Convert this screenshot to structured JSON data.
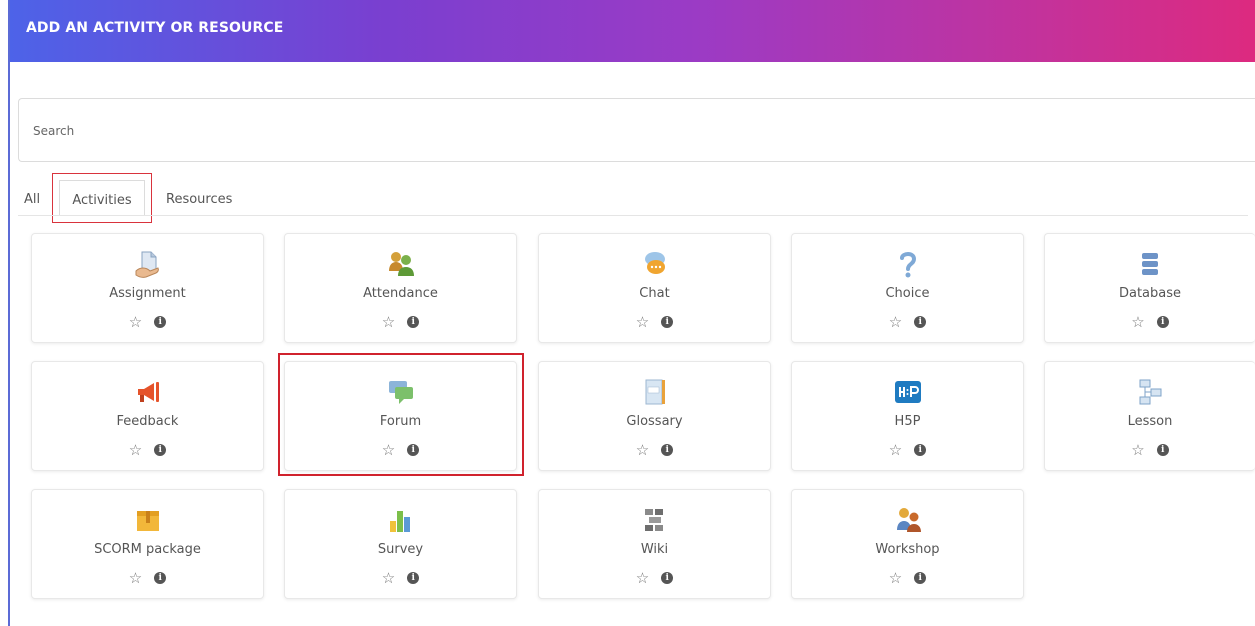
{
  "modal": {
    "title": "ADD AN ACTIVITY OR RESOURCE"
  },
  "search": {
    "placeholder": "Search",
    "value": ""
  },
  "tabs": [
    {
      "label": "All"
    },
    {
      "label": "Activities",
      "selected": true
    },
    {
      "label": "Resources"
    }
  ],
  "cards": [
    {
      "label": "Assignment",
      "icon": "assignment-icon"
    },
    {
      "label": "Attendance",
      "icon": "attendance-icon"
    },
    {
      "label": "Chat",
      "icon": "chat-icon"
    },
    {
      "label": "Choice",
      "icon": "choice-icon"
    },
    {
      "label": "Database",
      "icon": "database-icon"
    },
    {
      "label": "Feedback",
      "icon": "feedback-icon"
    },
    {
      "label": "Forum",
      "icon": "forum-icon"
    },
    {
      "label": "Glossary",
      "icon": "glossary-icon"
    },
    {
      "label": "H5P",
      "icon": "h5p-icon"
    },
    {
      "label": "Lesson",
      "icon": "lesson-icon"
    },
    {
      "label": "SCORM package",
      "icon": "scorm-icon"
    },
    {
      "label": "Survey",
      "icon": "survey-icon"
    },
    {
      "label": "Wiki",
      "icon": "wiki-icon"
    },
    {
      "label": "Workshop",
      "icon": "workshop-icon"
    }
  ],
  "actions": {
    "star_glyph": "☆",
    "info_glyph": "i"
  },
  "colors": {
    "header_gradient_start": "#4d63e8",
    "header_gradient_end": "#dd2a7f",
    "highlight": "#d0222d"
  }
}
